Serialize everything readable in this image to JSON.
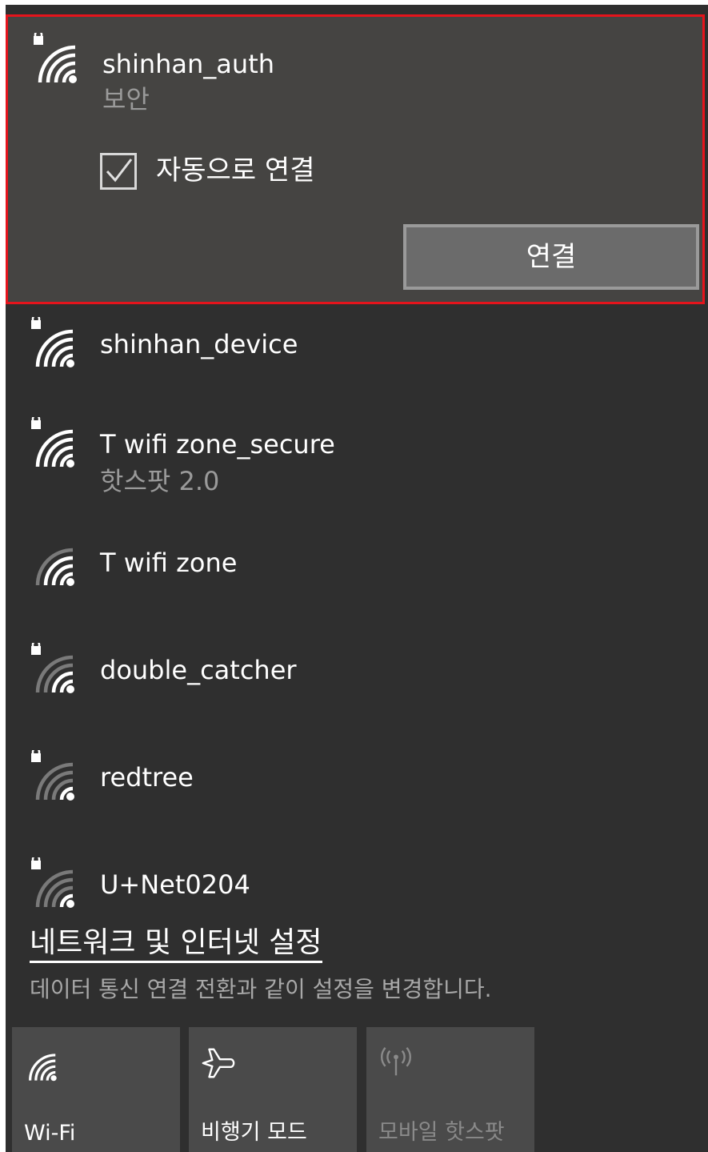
{
  "networks": {
    "selected": {
      "name": "shinhan_auth",
      "status": "보안",
      "auto_connect_label": "자동으로 연결",
      "auto_connect_checked": true,
      "connect_button": "연결"
    },
    "list": [
      {
        "name": "shinhan_device",
        "sub": "",
        "secured": true,
        "signal": 4
      },
      {
        "name": "T wifi zone_secure",
        "sub": "핫스팟 2.0",
        "secured": true,
        "signal": 4
      },
      {
        "name": "T wifi zone",
        "sub": "",
        "secured": false,
        "signal": 3
      },
      {
        "name": "double_catcher",
        "sub": "",
        "secured": true,
        "signal": 2
      },
      {
        "name": "redtree",
        "sub": "",
        "secured": true,
        "signal": 1
      },
      {
        "name": "U+Net0204",
        "sub": "",
        "secured": true,
        "signal": 1
      }
    ]
  },
  "settings": {
    "link": "네트워크 및 인터넷 설정",
    "description": "데이터 통신 연결 전환과 같이 설정을 변경합니다."
  },
  "quick_actions": [
    {
      "label": "Wi-Fi",
      "icon": "wifi-icon",
      "enabled": true
    },
    {
      "label": "비행기 모드",
      "icon": "airplane-icon",
      "enabled": true
    },
    {
      "label": "모바일 핫스팟",
      "icon": "mobile-hotspot-icon",
      "enabled": false
    }
  ],
  "colors": {
    "panel_bg": "#2f2f2f",
    "selected_bg": "#454442",
    "highlight_border": "#e5141c",
    "tile_bg": "#4a4a4a"
  }
}
